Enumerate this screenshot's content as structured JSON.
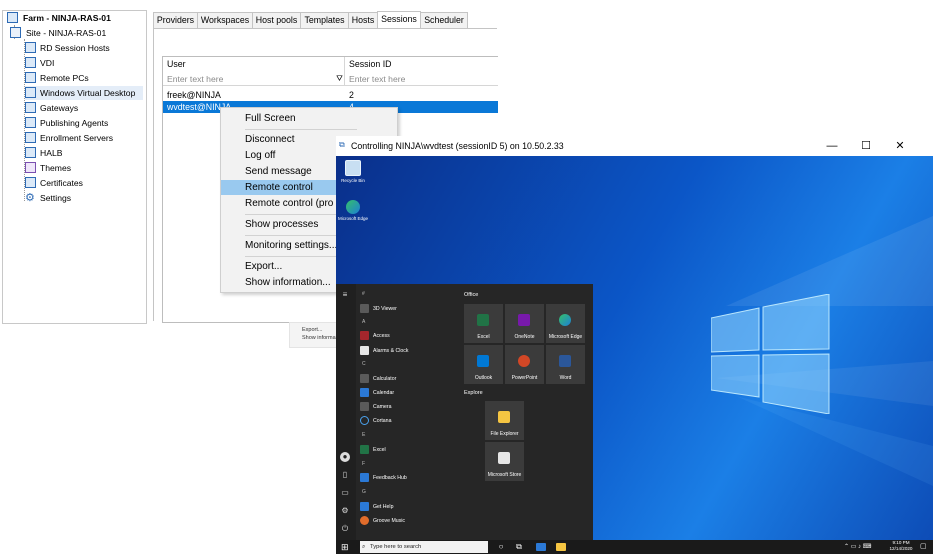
{
  "tree": {
    "items": [
      {
        "label": "Farm - NINJA-RAS-01",
        "icon": "farm-icon"
      },
      {
        "label": "Site - NINJA-RAS-01",
        "icon": "site-icon"
      },
      {
        "label": "RD Session Hosts",
        "icon": "rdsh-icon"
      },
      {
        "label": "VDI",
        "icon": "vdi-icon"
      },
      {
        "label": "Remote PCs",
        "icon": "remote-pc-icon"
      },
      {
        "label": "Windows Virtual Desktop",
        "icon": "wvd-icon"
      },
      {
        "label": "Gateways",
        "icon": "gateway-icon"
      },
      {
        "label": "Publishing Agents",
        "icon": "publishing-agent-icon"
      },
      {
        "label": "Enrollment Servers",
        "icon": "enrollment-icon"
      },
      {
        "label": "HALB",
        "icon": "halb-icon"
      },
      {
        "label": "Themes",
        "icon": "themes-icon"
      },
      {
        "label": "Certificates",
        "icon": "certificate-icon"
      },
      {
        "label": "Settings",
        "icon": "gear-icon"
      }
    ]
  },
  "tabs": [
    "Providers",
    "Workspaces",
    "Host pools",
    "Templates",
    "Hosts",
    "Sessions",
    "Scheduler"
  ],
  "active_tab": "Sessions",
  "grid": {
    "columns": [
      "User",
      "Session ID"
    ],
    "filter_placeholder": "Enter text here",
    "rows": [
      {
        "user": "freek@NINJA",
        "session_id": "2"
      },
      {
        "user": "wvdtest@NINJA",
        "session_id": "4"
      }
    ]
  },
  "context_menu": {
    "items": [
      "Full Screen",
      "Disconnect",
      "Log off",
      "Send message",
      "Remote control",
      "Remote control (pro",
      "Show processes",
      "Monitoring settings...",
      "Export...",
      "Show information..."
    ],
    "highlighted": "Remote control"
  },
  "ghost_menu": {
    "items": [
      "Export...",
      "Show informa"
    ]
  },
  "remote_window": {
    "title": "Controlling NINJA\\wvdtest (sessionID 5) on 10.50.2.33",
    "minimize": "—",
    "maximize": "☐",
    "close": "✕",
    "desktop_icons": [
      "Recycle Bin",
      "Microsoft Edge"
    ],
    "start_menu": {
      "app_list": [
        {
          "letter": "#",
          "apps": [
            "3D Viewer"
          ]
        },
        {
          "letter": "A",
          "apps": [
            "Access",
            "Alarms & Clock"
          ]
        },
        {
          "letter": "C",
          "apps": [
            "Calculator",
            "Calendar",
            "Camera",
            "Cortana"
          ]
        },
        {
          "letter": "E",
          "apps": [
            "Excel"
          ]
        },
        {
          "letter": "F",
          "apps": [
            "Feedback Hub"
          ]
        },
        {
          "letter": "G",
          "apps": [
            "Get Help",
            "Groove Music"
          ]
        }
      ],
      "groups": [
        {
          "title": "Office",
          "tiles": [
            "Excel",
            "OneNote",
            "Microsoft Edge",
            "Outlook",
            "PowerPoint",
            "Word"
          ]
        },
        {
          "title": "Explore",
          "tiles": [
            "File Explorer",
            "Microsoft Store"
          ]
        }
      ]
    },
    "taskbar": {
      "search_placeholder": "Type here to search",
      "time": "9:10 PM",
      "date": "12/14/2020"
    }
  },
  "colors": {
    "selection": "#0a78d7",
    "menu_highlight": "#99c9ef",
    "taskbar": "#1a1a1a"
  }
}
